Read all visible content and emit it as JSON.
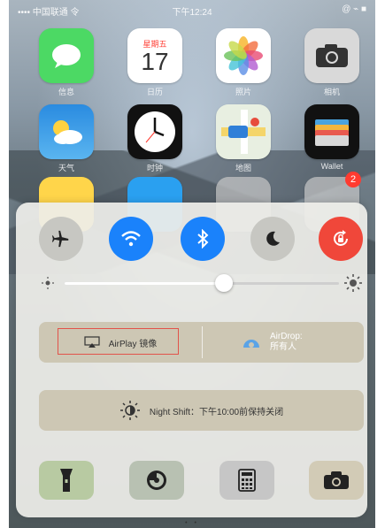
{
  "status_bar": {
    "left": "•••• 中国联通 令",
    "time": "下午12:24",
    "right": "@ ⌁ ■"
  },
  "home_apps": [
    {
      "name": "信息",
      "icon": "messages-icon"
    },
    {
      "name": "日历",
      "icon": "calendar-icon",
      "day_of_week": "星期五",
      "day": "17"
    },
    {
      "name": "照片",
      "icon": "photos-icon"
    },
    {
      "name": "相机",
      "icon": "camera-icon"
    },
    {
      "name": "天气",
      "icon": "weather-icon"
    },
    {
      "name": "时钟",
      "icon": "clock-icon"
    },
    {
      "name": "地图",
      "icon": "maps-icon"
    },
    {
      "name": "Wallet",
      "icon": "wallet-icon"
    },
    {
      "name": "",
      "icon": "notes-icon"
    },
    {
      "name": "",
      "icon": "app-store-icon"
    },
    {
      "name": "",
      "icon": "folder-icon"
    },
    {
      "name": "",
      "icon": "folder2-icon",
      "badge": "2"
    }
  ],
  "control_center": {
    "toggles": [
      {
        "name": "airplane-mode",
        "icon": "airplane-icon",
        "active": false
      },
      {
        "name": "wifi",
        "icon": "wifi-icon",
        "active": true,
        "color": "#1a82fb"
      },
      {
        "name": "bluetooth",
        "icon": "bluetooth-icon",
        "active": true,
        "color": "#1a82fb"
      },
      {
        "name": "do-not-disturb",
        "icon": "moon-icon",
        "active": false
      },
      {
        "name": "rotation-lock",
        "icon": "rotation-lock-icon",
        "active": true,
        "color": "#f0473a"
      }
    ],
    "brightness": 0.58,
    "airplay_label": "AirPlay 镜像",
    "airdrop_label_line1": "AirDrop:",
    "airdrop_label_line2": "所有人",
    "night_shift_label": "Night Shift：下午10:00前保持关闭",
    "tools": [
      {
        "name": "flashlight",
        "icon": "flashlight-icon"
      },
      {
        "name": "timer",
        "icon": "timer-icon"
      },
      {
        "name": "calculator",
        "icon": "calculator-icon"
      },
      {
        "name": "camera",
        "icon": "camera-icon"
      }
    ]
  },
  "page_dots": "• •",
  "colors": {
    "active_blue": "#1a82fb",
    "rotation_red": "#f0473a",
    "toggle_gray": "#c7c7c2",
    "highlight_outline": "#e2534a"
  }
}
